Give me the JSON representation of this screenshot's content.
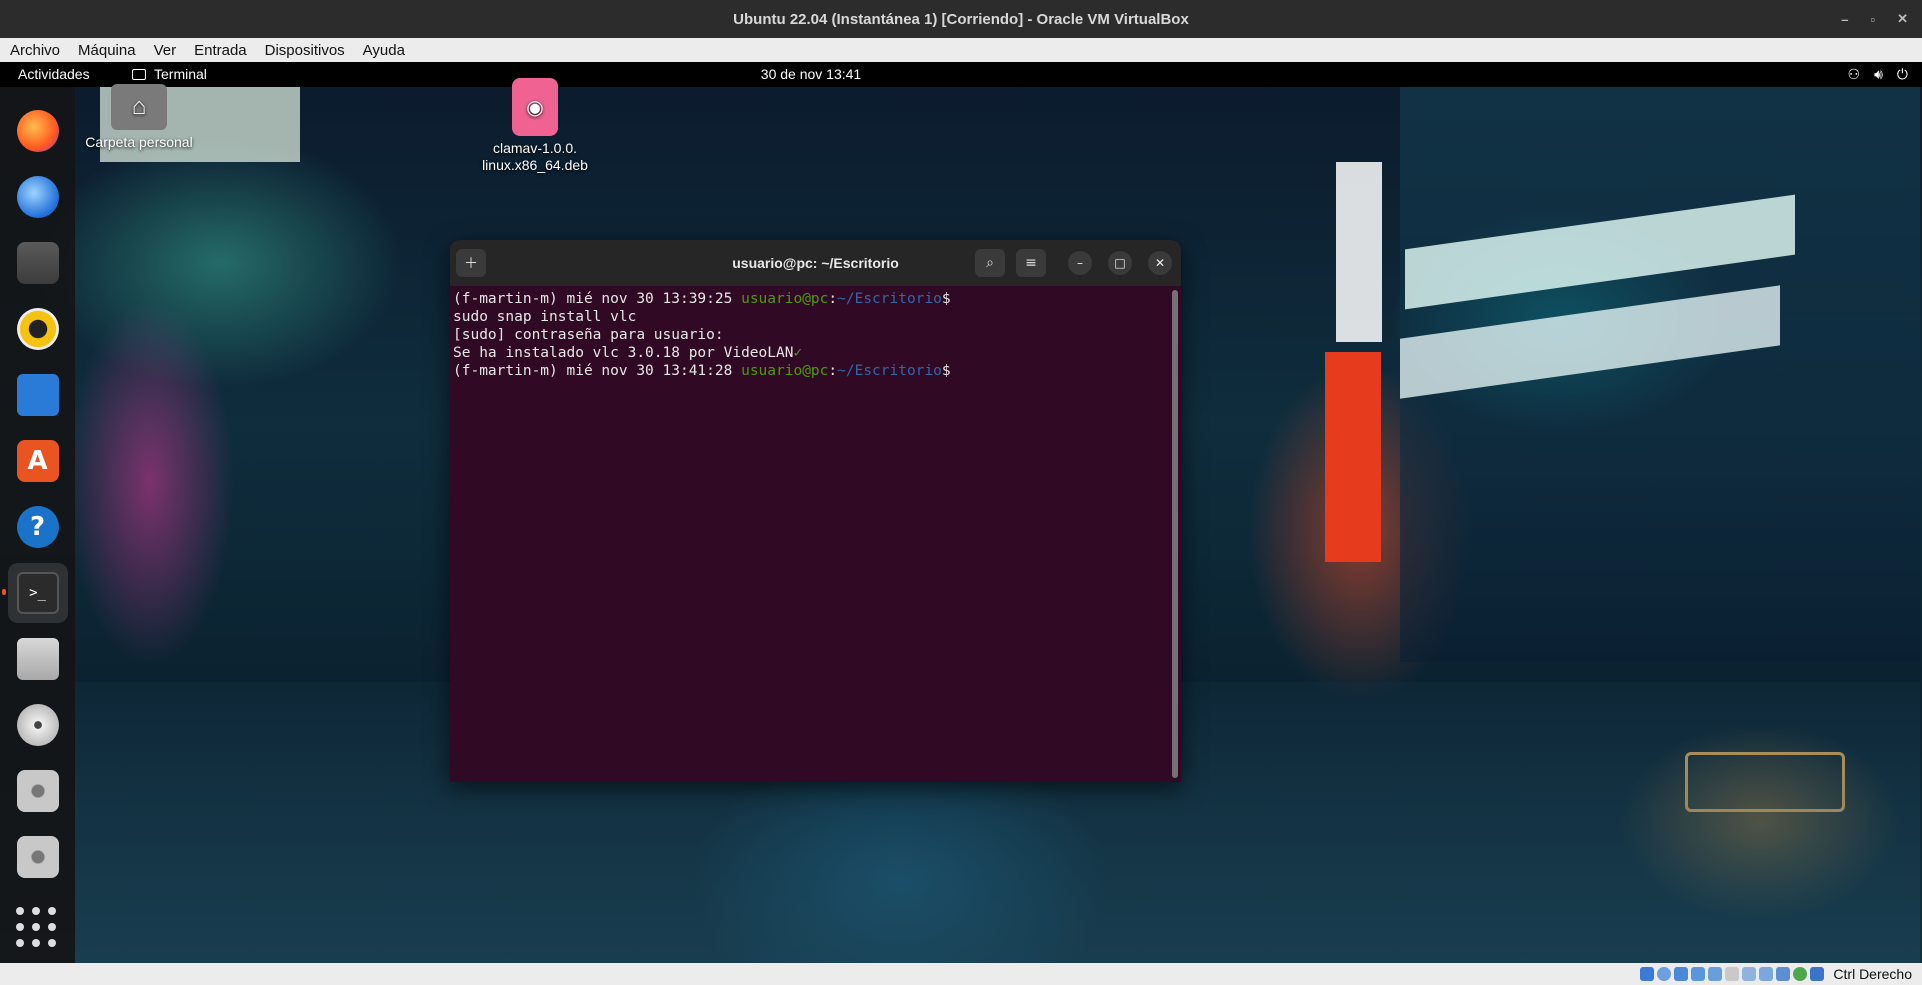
{
  "host": {
    "title": "Ubuntu 22.04 (Instantánea 1) [Corriendo] - Oracle VM VirtualBox",
    "menu": [
      "Archivo",
      "Máquina",
      "Ver",
      "Entrada",
      "Dispositivos",
      "Ayuda"
    ],
    "host_key": "Ctrl Derecho"
  },
  "topbar": {
    "activities": "Actividades",
    "app_name": "Terminal",
    "clock": "30 de nov  13:41"
  },
  "desktop": {
    "home_label": "Carpeta personal",
    "deb_label": "clamav-1.0.0.\nlinux.x86_64.deb"
  },
  "dock": [
    "Firefox",
    "Thunderbird",
    "Archivos",
    "Rhythmbox",
    "LibreOffice Writer",
    "Ubuntu Software",
    "Ayuda",
    "Terminal",
    "Disco",
    "DVD",
    "Disco 2",
    "Disco 3"
  ],
  "terminal": {
    "title": "usuario@pc: ~/Escritorio",
    "lines": {
      "l1_prefix": "(f-martin-m) mié nov 30 13:39:25 ",
      "l1_user": "usuario@pc",
      "l1_colon": ":",
      "l1_path": "~/Escritorio",
      "l1_dollar": "$",
      "l2": "sudo snap install vlc",
      "l3": "[sudo] contraseña para usuario:",
      "l4": "Se ha instalado vlc 3.0.18 por VideoLAN",
      "l4_check": "✓",
      "l5_prefix": "(f-martin-m) mié nov 30 13:41:28 ",
      "l5_user": "usuario@pc",
      "l5_colon": ":",
      "l5_path": "~/Escritorio",
      "l5_dollar": "$"
    }
  },
  "colors": {
    "terminal_bg": "#300a24",
    "prompt_user": "#4e9a06",
    "prompt_path": "#3465a4",
    "accent": "#e95420"
  }
}
